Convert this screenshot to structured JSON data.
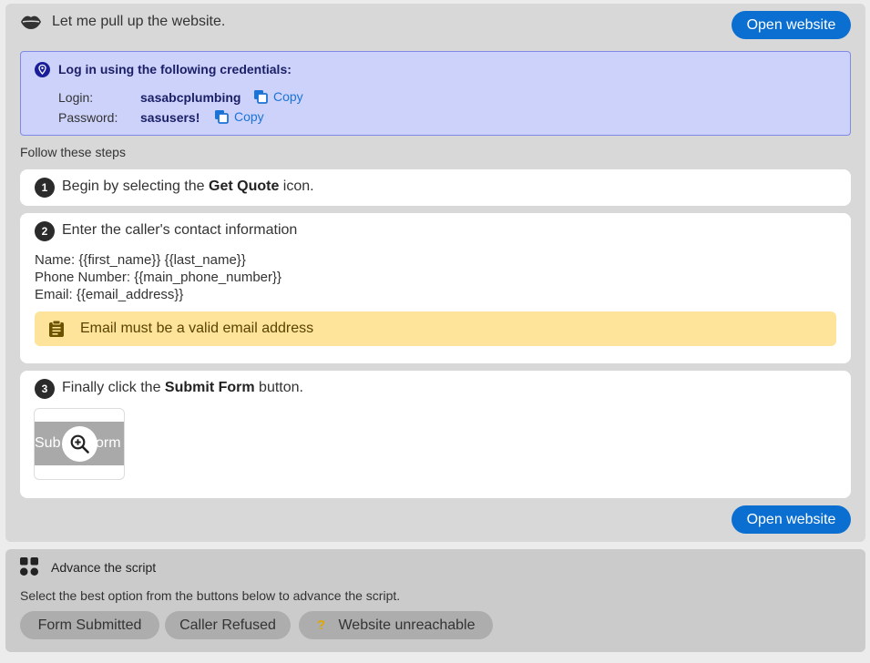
{
  "intro": {
    "text": "Let me pull up the website."
  },
  "buttons": {
    "open_website_top": "Open website",
    "open_website_bottom": "Open website"
  },
  "credentials": {
    "title": "Log in using the following credentials:",
    "login_label": "Login:",
    "login_value": "sasabcplumbing",
    "password_label": "Password:",
    "password_value": "sasusers!",
    "copy_label": "Copy"
  },
  "steps_heading": "Follow these steps",
  "steps": [
    {
      "number": "1",
      "text_before": "Begin by selecting the ",
      "bold": "Get Quote",
      "text_after": " icon."
    },
    {
      "number": "2",
      "text": "Enter the caller's contact information",
      "lines": [
        "Name: {{first_name}} {{last_name}}",
        "Phone Number: {{main_phone_number}}",
        "Email: {{email_address}}"
      ],
      "note": "Email must be a valid email address"
    },
    {
      "number": "3",
      "text_before": "Finally click the ",
      "bold": "Submit Form",
      "text_after": " button.",
      "thumb_left": "Sub",
      "thumb_right": "orm"
    }
  ],
  "advance": {
    "title": "Advance the script",
    "description": "Select the best option from the buttons below to advance the script.",
    "options": [
      "Form Submitted",
      "Caller Refused",
      "Website unreachable"
    ],
    "option3_icon": "?"
  },
  "colors": {
    "accent": "#0b6fd1",
    "cred_bg": "#cdd2fb",
    "note_bg": "#fde49a"
  },
  "icons": [
    "lips-icon",
    "map-pin-icon",
    "copy-icon",
    "clipboard-note-icon",
    "zoom-in-icon",
    "grid-icon",
    "question-icon"
  ]
}
